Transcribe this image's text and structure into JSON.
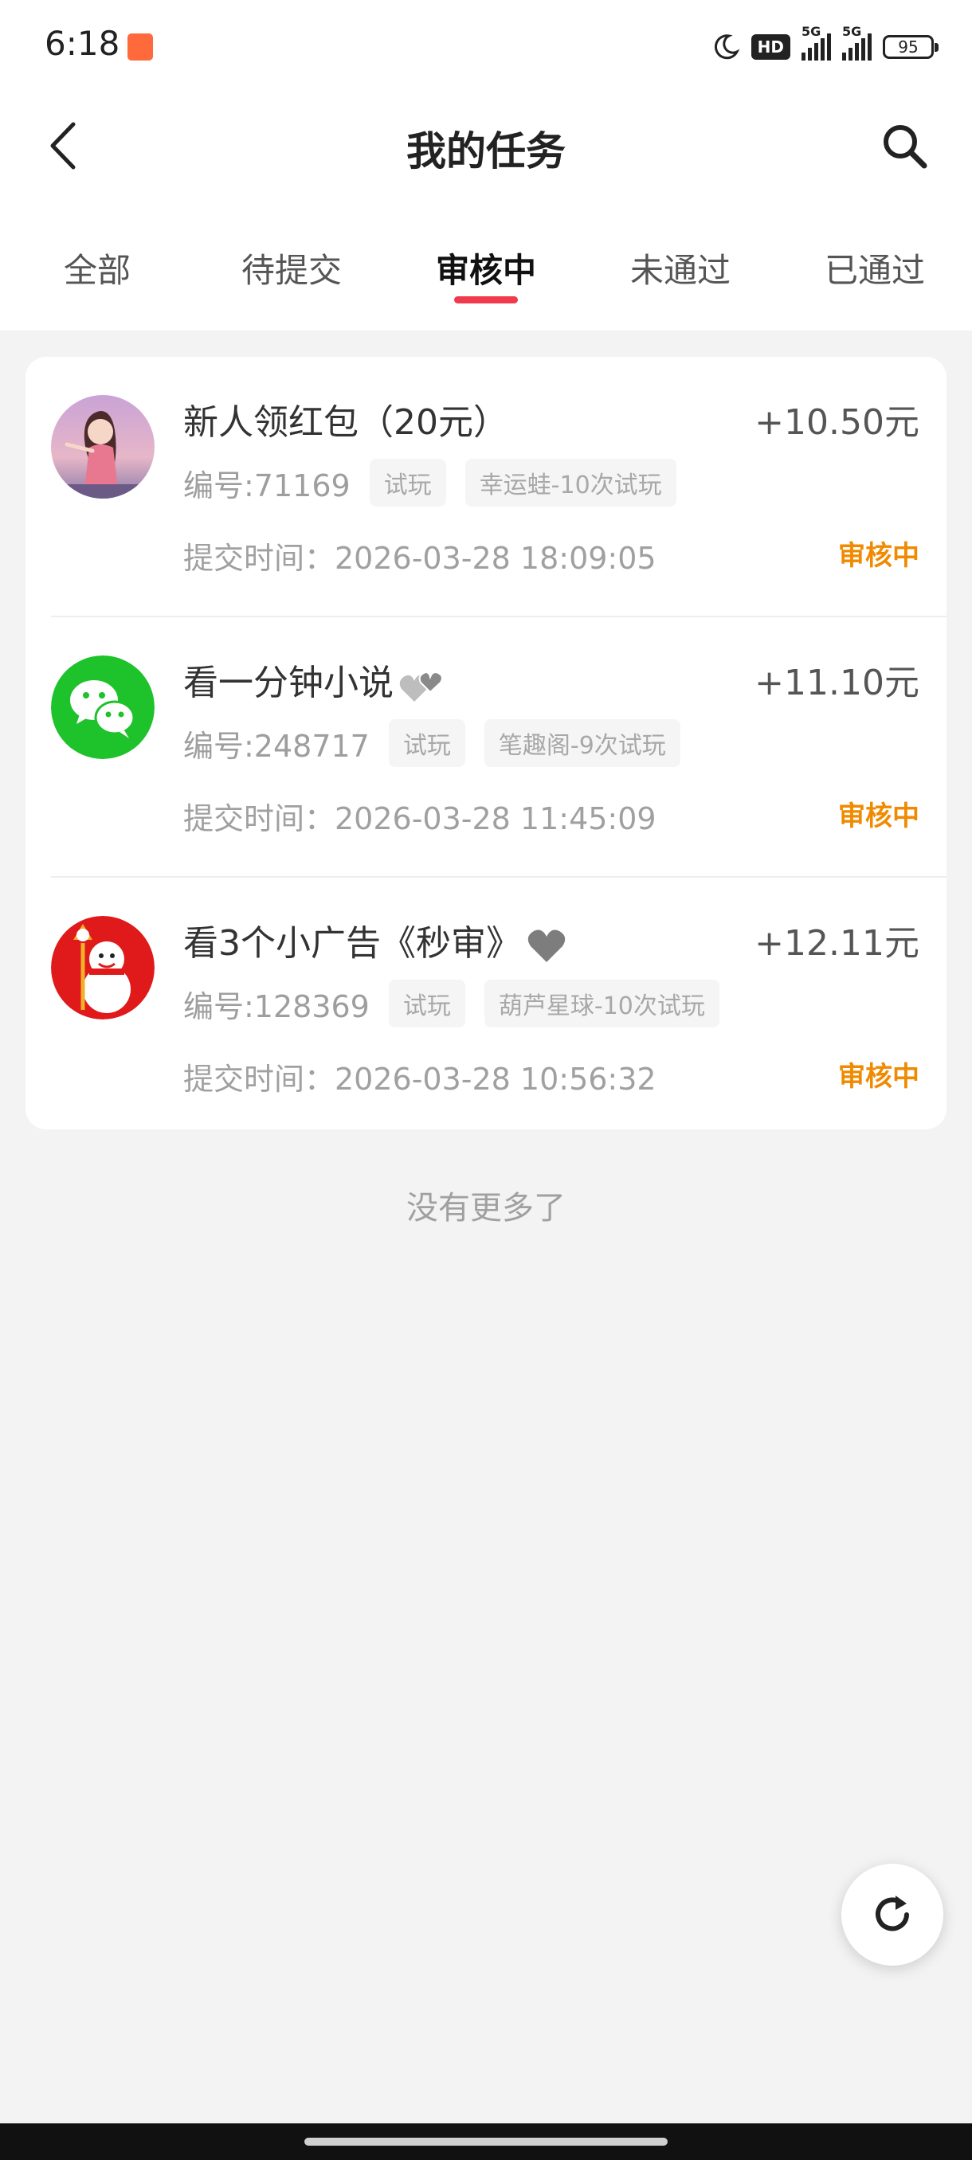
{
  "status_bar": {
    "time": "6:18",
    "hd_label": "HD",
    "network_1": "5G",
    "network_2": "5G",
    "battery": "95"
  },
  "header": {
    "title": "我的任务"
  },
  "tabs": [
    {
      "label": "全部",
      "active": false
    },
    {
      "label": "待提交",
      "active": false
    },
    {
      "label": "审核中",
      "active": true
    },
    {
      "label": "未通过",
      "active": false
    },
    {
      "label": "已通过",
      "active": false
    }
  ],
  "tasks": [
    {
      "title": "新人领红包（20元）",
      "reward": "+10.50元",
      "id": "编号:71169",
      "tags": [
        "试玩",
        "幸运蛙-10次试玩"
      ],
      "submit_time": "提交时间：2026-03-28 18:09:05",
      "status": "审核中",
      "avatar": "girl-avatar"
    },
    {
      "title": "看一分钟小说",
      "reward": "+11.10元",
      "id": "编号:248717",
      "tags": [
        "试玩",
        "笔趣阁-9次试玩"
      ],
      "submit_time": "提交时间：2026-03-28 11:45:09",
      "status": "审核中",
      "avatar": "wechat-icon"
    },
    {
      "title": "看3个小广告《秒审》",
      "reward": "+12.11元",
      "id": "编号:128369",
      "tags": [
        "试玩",
        "葫芦星球-10次试玩"
      ],
      "submit_time": "提交时间：2026-03-28 10:56:32",
      "status": "审核中",
      "avatar": "snowman-avatar"
    }
  ],
  "footer": {
    "no_more": "没有更多了"
  },
  "colors": {
    "accent": "#f03a4d",
    "status": "#f08a00",
    "background": "#f3f3f3"
  }
}
